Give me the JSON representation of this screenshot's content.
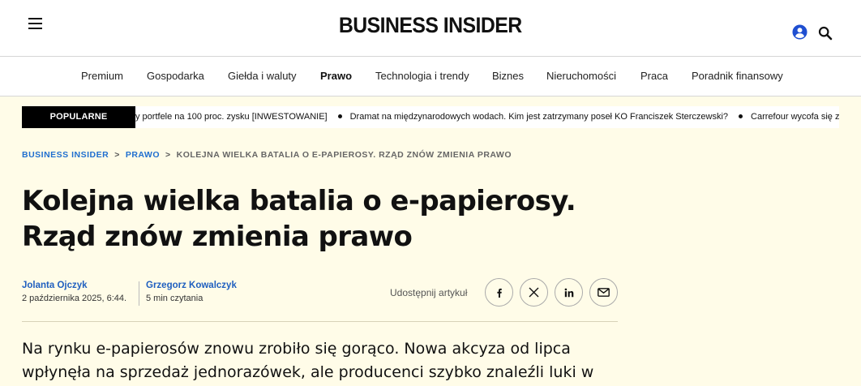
{
  "header": {
    "logo": "BUSINESS INSIDER",
    "menu_icon": "hamburger-menu-icon",
    "user_icon": "user-account-icon",
    "search_icon": "search-icon"
  },
  "nav": {
    "items": [
      {
        "label": "Premium"
      },
      {
        "label": "Gospodarka"
      },
      {
        "label": "Giełda i waluty"
      },
      {
        "label": "Prawo",
        "active": true
      },
      {
        "label": "Technologia i trendy"
      },
      {
        "label": "Biznes"
      },
      {
        "label": "Nieruchomości"
      },
      {
        "label": "Praca"
      },
      {
        "label": "Poradnik finansowy"
      }
    ]
  },
  "ticker": {
    "label": "POPULARNE",
    "items": [
      "y portfele na 100 proc. zysku [INWESTOWANIE]",
      "Dramat na międzynarodowych wodach. Kim jest zatrzymany poseł KO Franciszek Sterczewski?",
      "Carrefour wycofa się z"
    ]
  },
  "breadcrumb": {
    "items": [
      {
        "label": "BUSINESS INSIDER"
      },
      {
        "label": "PRAWO"
      },
      {
        "label": "KOLEJNA WIELKA BATALIA O E-PAPIEROSY. RZĄD ZNÓW ZMIENIA PRAWO"
      }
    ]
  },
  "article": {
    "headline_line1": "Kolejna wielka batalia o e-papierosy.",
    "headline_line2": "Rząd znów zmienia prawo",
    "authors": [
      {
        "name": "Jolanta Ojczyk",
        "meta": "2 października 2025, 6:44."
      },
      {
        "name": "Grzegorz Kowalczyk",
        "meta": "5 min czytania"
      }
    ],
    "share": {
      "label": "Udostępnij artykuł",
      "buttons": [
        {
          "icon": "facebook-icon"
        },
        {
          "icon": "x-twitter-icon"
        },
        {
          "icon": "linkedin-icon"
        },
        {
          "icon": "email-icon"
        }
      ]
    },
    "lead_line1": "Na rynku e-papierosów znowu zrobiło się gorąco. Nowa akcyza od lipca",
    "lead_line2": "wpłynęła na sprzedaż jednorazówek, ale producenci szybko znaleźli luki w"
  },
  "colors": {
    "page_background": "#fffce8",
    "link_blue": "#1f6fcf",
    "ticker_label_bg": "#000000"
  }
}
